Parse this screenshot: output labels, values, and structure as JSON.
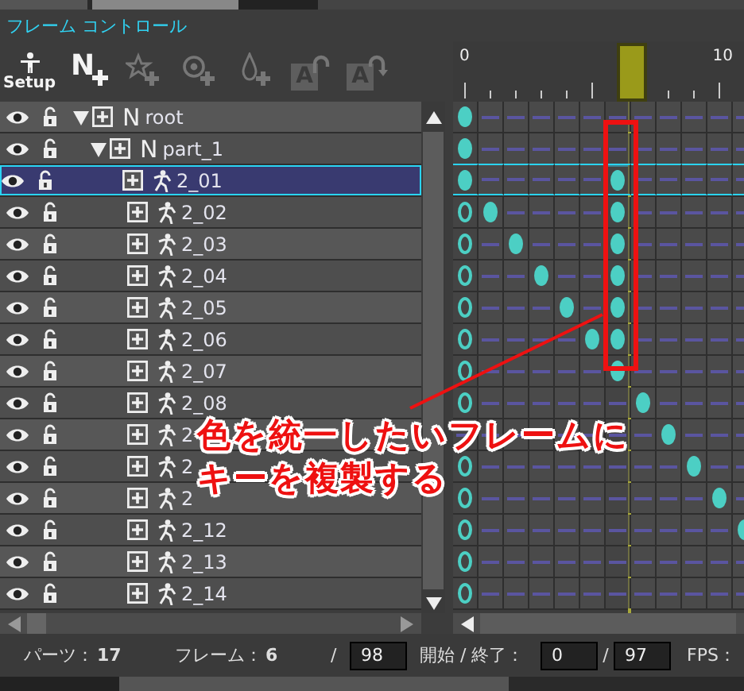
{
  "panel": {
    "title": "フレーム コントロール"
  },
  "toolbar": [
    {
      "kind": "setup",
      "label": "Setup",
      "disabled": false
    },
    {
      "kind": "new-node",
      "glyph": "N",
      "disabled": false
    },
    {
      "kind": "new-star",
      "disabled": true
    },
    {
      "kind": "new-circle",
      "disabled": true
    },
    {
      "kind": "new-drop",
      "disabled": true
    },
    {
      "kind": "rotate-left",
      "glyph": "A",
      "disabled": true
    },
    {
      "kind": "rotate-right",
      "glyph": "A",
      "disabled": true
    }
  ],
  "ruler": {
    "labels": [
      "0",
      "10"
    ],
    "playhead": {
      "level": 0.6
    }
  },
  "layers": [
    {
      "kind": "node",
      "glyph": "N",
      "name": "root",
      "expanded": true,
      "selected": false,
      "keys": [
        {
          "kind": "key"
        }
      ],
      "children": [
        {
          "kind": "node",
          "glyph": "N",
          "name": "part_1",
          "expanded": true,
          "selected": false,
          "keys": [
            {
              "kind": "key"
            }
          ],
          "children": [
            {
              "kind": "part",
              "name": "2_01",
              "selected": true,
              "keys": [
                {
                  "kind": "key"
                },
                {
                  "kind": "none"
                },
                {
                  "kind": "none"
                },
                {
                  "kind": "none"
                },
                {
                  "kind": "none"
                },
                {
                  "kind": "none"
                },
                {
                  "kind": "key"
                }
              ]
            },
            {
              "kind": "part",
              "name": "2_02",
              "selected": false,
              "keys": [
                {
                  "kind": "base"
                },
                {
                  "kind": "key"
                },
                {
                  "kind": "none"
                },
                {
                  "kind": "none"
                },
                {
                  "kind": "none"
                },
                {
                  "kind": "none"
                },
                {
                  "kind": "key"
                }
              ]
            },
            {
              "kind": "part",
              "name": "2_03",
              "selected": false,
              "keys": [
                {
                  "kind": "base"
                },
                {
                  "kind": "none"
                },
                {
                  "kind": "key"
                },
                {
                  "kind": "none"
                },
                {
                  "kind": "none"
                },
                {
                  "kind": "none"
                },
                {
                  "kind": "key"
                }
              ]
            },
            {
              "kind": "part",
              "name": "2_04",
              "selected": false,
              "keys": [
                {
                  "kind": "base"
                },
                {
                  "kind": "none"
                },
                {
                  "kind": "none"
                },
                {
                  "kind": "key"
                },
                {
                  "kind": "none"
                },
                {
                  "kind": "none"
                },
                {
                  "kind": "key"
                }
              ]
            },
            {
              "kind": "part",
              "name": "2_05",
              "selected": false,
              "keys": [
                {
                  "kind": "base"
                },
                {
                  "kind": "none"
                },
                {
                  "kind": "none"
                },
                {
                  "kind": "none"
                },
                {
                  "kind": "key"
                },
                {
                  "kind": "none"
                },
                {
                  "kind": "key"
                }
              ]
            },
            {
              "kind": "part",
              "name": "2_06",
              "selected": false,
              "keys": [
                {
                  "kind": "base"
                },
                {
                  "kind": "none"
                },
                {
                  "kind": "none"
                },
                {
                  "kind": "none"
                },
                {
                  "kind": "none"
                },
                {
                  "kind": "key"
                },
                {
                  "kind": "key"
                }
              ]
            },
            {
              "kind": "part",
              "name": "2_07",
              "selected": false,
              "keys": [
                {
                  "kind": "base"
                },
                {
                  "kind": "none"
                },
                {
                  "kind": "none"
                },
                {
                  "kind": "none"
                },
                {
                  "kind": "none"
                },
                {
                  "kind": "none"
                },
                {
                  "kind": "key"
                }
              ]
            },
            {
              "kind": "part",
              "name": "2_08",
              "selected": false,
              "keys": [
                {
                  "kind": "base"
                },
                {
                  "kind": "none"
                },
                {
                  "kind": "none"
                },
                {
                  "kind": "none"
                },
                {
                  "kind": "none"
                },
                {
                  "kind": "none"
                },
                {
                  "kind": "none"
                },
                {
                  "kind": "key"
                }
              ]
            },
            {
              "kind": "part",
              "name": "2",
              "selected": false,
              "keys": [
                {
                  "kind": "none"
                },
                {
                  "kind": "none"
                },
                {
                  "kind": "none"
                },
                {
                  "kind": "none"
                },
                {
                  "kind": "none"
                },
                {
                  "kind": "none"
                },
                {
                  "kind": "none"
                },
                {
                  "kind": "none"
                },
                {
                  "kind": "key"
                }
              ]
            },
            {
              "kind": "part",
              "name": "2",
              "selected": false,
              "keys": [
                {
                  "kind": "base"
                },
                {
                  "kind": "none"
                },
                {
                  "kind": "none"
                },
                {
                  "kind": "none"
                },
                {
                  "kind": "none"
                },
                {
                  "kind": "none"
                },
                {
                  "kind": "none"
                },
                {
                  "kind": "none"
                },
                {
                  "kind": "none"
                },
                {
                  "kind": "key"
                }
              ]
            },
            {
              "kind": "part",
              "name": "2",
              "selected": false,
              "keys": [
                {
                  "kind": "base"
                },
                {
                  "kind": "none"
                },
                {
                  "kind": "none"
                },
                {
                  "kind": "none"
                },
                {
                  "kind": "none"
                },
                {
                  "kind": "none"
                },
                {
                  "kind": "none"
                },
                {
                  "kind": "none"
                },
                {
                  "kind": "none"
                },
                {
                  "kind": "none"
                },
                {
                  "kind": "key"
                }
              ]
            },
            {
              "kind": "part",
              "name": "2_12",
              "selected": false,
              "keys": [
                {
                  "kind": "base"
                },
                {
                  "kind": "none"
                },
                {
                  "kind": "none"
                },
                {
                  "kind": "none"
                },
                {
                  "kind": "none"
                },
                {
                  "kind": "none"
                },
                {
                  "kind": "none"
                },
                {
                  "kind": "none"
                },
                {
                  "kind": "none"
                },
                {
                  "kind": "none"
                },
                {
                  "kind": "none"
                },
                {
                  "kind": "key"
                }
              ]
            },
            {
              "kind": "part",
              "name": "2_13",
              "selected": false,
              "keys": [
                {
                  "kind": "base"
                }
              ]
            },
            {
              "kind": "part",
              "name": "2_14",
              "selected": false,
              "keys": [
                {
                  "kind": "base"
                }
              ]
            }
          ]
        }
      ]
    }
  ],
  "annotation": {
    "lines": [
      "色を統一したいフレームに",
      "キーを複製する"
    ]
  },
  "status_bar": {
    "parts": {
      "label": "パーツ：",
      "value": "17"
    },
    "frame": {
      "label": "フレーム：",
      "value": "6",
      "separator": "/",
      "total": "98"
    },
    "range": {
      "label": "開始 / 終了：",
      "start": "0",
      "separator": "/",
      "end": "97"
    },
    "fps": {
      "label": "FPS："
    }
  }
}
